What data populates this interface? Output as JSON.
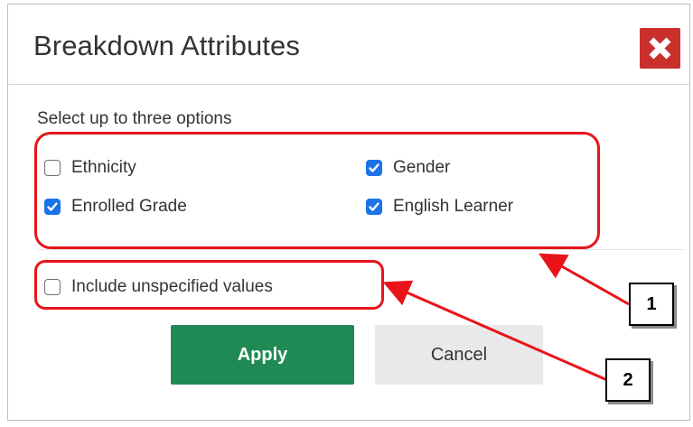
{
  "dialog": {
    "title": "Breakdown Attributes",
    "instructions": "Select up to three options",
    "options": [
      {
        "label": "Ethnicity",
        "checked": false
      },
      {
        "label": "Gender",
        "checked": true
      },
      {
        "label": "Enrolled Grade",
        "checked": true
      },
      {
        "label": "English Learner",
        "checked": true
      }
    ],
    "include_unspecified": {
      "label": "Include unspecified values",
      "checked": false
    },
    "apply_label": "Apply",
    "cancel_label": "Cancel"
  },
  "callouts": {
    "one": "1",
    "two": "2"
  },
  "colors": {
    "close_bg": "#c9302c",
    "checkbox_checked": "#1a73e8",
    "apply_bg": "#1f8a54",
    "cancel_bg": "#e9e9e9",
    "annotation_red": "#e8141a"
  },
  "icons": {
    "close": "close-x-icon",
    "checkmark": "checkmark-icon"
  }
}
